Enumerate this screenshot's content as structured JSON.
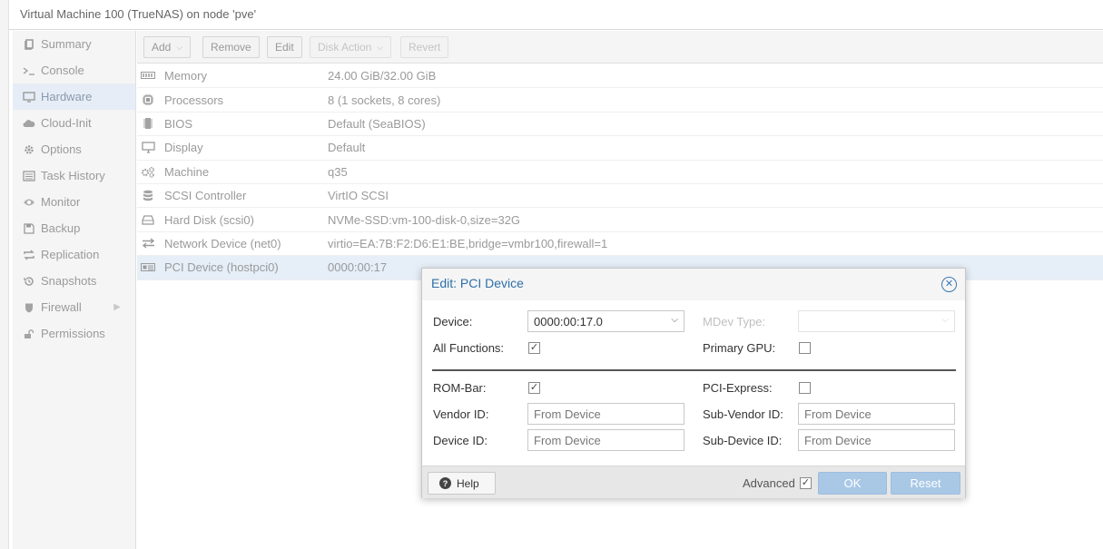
{
  "window": {
    "title": "Virtual Machine 100 (TrueNAS) on node 'pve'"
  },
  "sidebar": {
    "items": [
      {
        "label": "Summary",
        "icon": "book-icon",
        "selected": false
      },
      {
        "label": "Console",
        "icon": "terminal-icon",
        "selected": false
      },
      {
        "label": "Hardware",
        "icon": "monitor-icon",
        "selected": true
      },
      {
        "label": "Cloud-Init",
        "icon": "cloud-icon",
        "selected": false
      },
      {
        "label": "Options",
        "icon": "gear-icon",
        "selected": false
      },
      {
        "label": "Task History",
        "icon": "list-icon",
        "selected": false
      },
      {
        "label": "Monitor",
        "icon": "eye-icon",
        "selected": false
      },
      {
        "label": "Backup",
        "icon": "floppy-icon",
        "selected": false
      },
      {
        "label": "Replication",
        "icon": "sync-icon",
        "selected": false
      },
      {
        "label": "Snapshots",
        "icon": "history-icon",
        "selected": false
      },
      {
        "label": "Firewall",
        "icon": "shield-icon",
        "selected": false,
        "has_submenu": true
      },
      {
        "label": "Permissions",
        "icon": "unlock-icon",
        "selected": false
      }
    ]
  },
  "toolbar": {
    "add_label": "Add",
    "remove_label": "Remove",
    "edit_label": "Edit",
    "disk_action_label": "Disk Action",
    "revert_label": "Revert"
  },
  "hardware": {
    "rows": [
      {
        "name": "Memory",
        "value": "24.00 GiB/32.00 GiB",
        "icon": "memory-icon"
      },
      {
        "name": "Processors",
        "value": "8 (1 sockets, 8 cores)",
        "icon": "cpu-icon"
      },
      {
        "name": "BIOS",
        "value": "Default (SeaBIOS)",
        "icon": "microchip-icon"
      },
      {
        "name": "Display",
        "value": "Default",
        "icon": "desktop-icon"
      },
      {
        "name": "Machine",
        "value": "q35",
        "icon": "cogs-icon"
      },
      {
        "name": "SCSI Controller",
        "value": "VirtIO SCSI",
        "icon": "database-icon"
      },
      {
        "name": "Hard Disk (scsi0)",
        "value": "NVMe-SSD:vm-100-disk-0,size=32G",
        "icon": "hdd-icon"
      },
      {
        "name": "Network Device (net0)",
        "value": "virtio=EA:7B:F2:D6:E1:BE,bridge=vmbr100,firewall=1",
        "icon": "exchange-icon"
      },
      {
        "name": "PCI Device (hostpci0)",
        "value": "0000:00:17",
        "icon": "pci-card-icon",
        "selected": true
      }
    ]
  },
  "dialog": {
    "title": "Edit: PCI Device",
    "device_label": "Device:",
    "device_value": "0000:00:17.0",
    "mdev_label": "MDev Type:",
    "mdev_value": "",
    "all_functions_label": "All Functions:",
    "all_functions_checked": true,
    "primary_gpu_label": "Primary GPU:",
    "primary_gpu_checked": false,
    "rombar_label": "ROM-Bar:",
    "rombar_checked": true,
    "pcie_label": "PCI-Express:",
    "pcie_checked": false,
    "vendor_id_label": "Vendor ID:",
    "vendor_id_placeholder": "From Device",
    "sub_vendor_id_label": "Sub-Vendor ID:",
    "sub_vendor_id_placeholder": "From Device",
    "device_id_label": "Device ID:",
    "device_id_placeholder": "From Device",
    "sub_device_id_label": "Sub-Device ID:",
    "sub_device_id_placeholder": "From Device",
    "help_label": "Help",
    "advanced_label": "Advanced",
    "advanced_checked": true,
    "ok_label": "OK",
    "reset_label": "Reset"
  },
  "colors": {
    "accent": "#2f70a9",
    "selection": "#e6edf6",
    "button_primary_disabled": "#a9c8e6"
  }
}
